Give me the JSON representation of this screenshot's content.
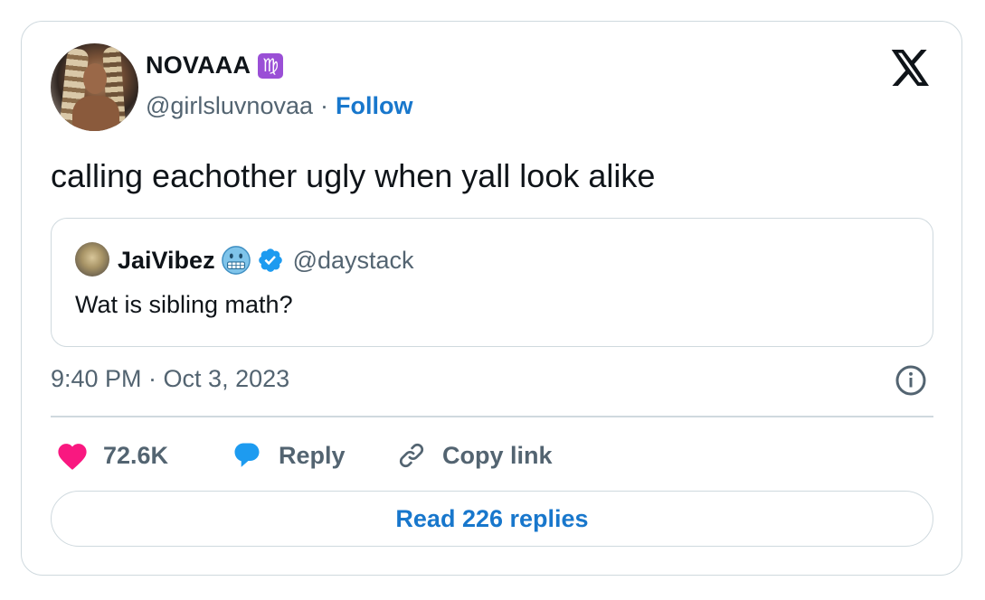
{
  "tweet": {
    "author": {
      "display_name": "NOVAAA",
      "emoji_icon": "virgo-icon",
      "handle": "@girlsluvnovaa",
      "separator": "·",
      "follow_label": "Follow"
    },
    "text": "calling eachother ugly when yall look alike",
    "quoted": {
      "display_name": "JaiVibez",
      "emoji_icon": "cold-face-icon",
      "verified": true,
      "handle": "@daystack",
      "text": "Wat is sibling math?"
    },
    "timestamp": "9:40 PM · Oct 3, 2023",
    "actions": {
      "like_count": "72.6K",
      "reply_label": "Reply",
      "copy_label": "Copy link"
    },
    "read_replies_label": "Read 226 replies"
  },
  "colors": {
    "accent_blue": "#1877cc",
    "like_pink": "#f91880",
    "reply_blue": "#1d9bf0",
    "muted_text": "#536471",
    "border": "#cfd9de"
  }
}
